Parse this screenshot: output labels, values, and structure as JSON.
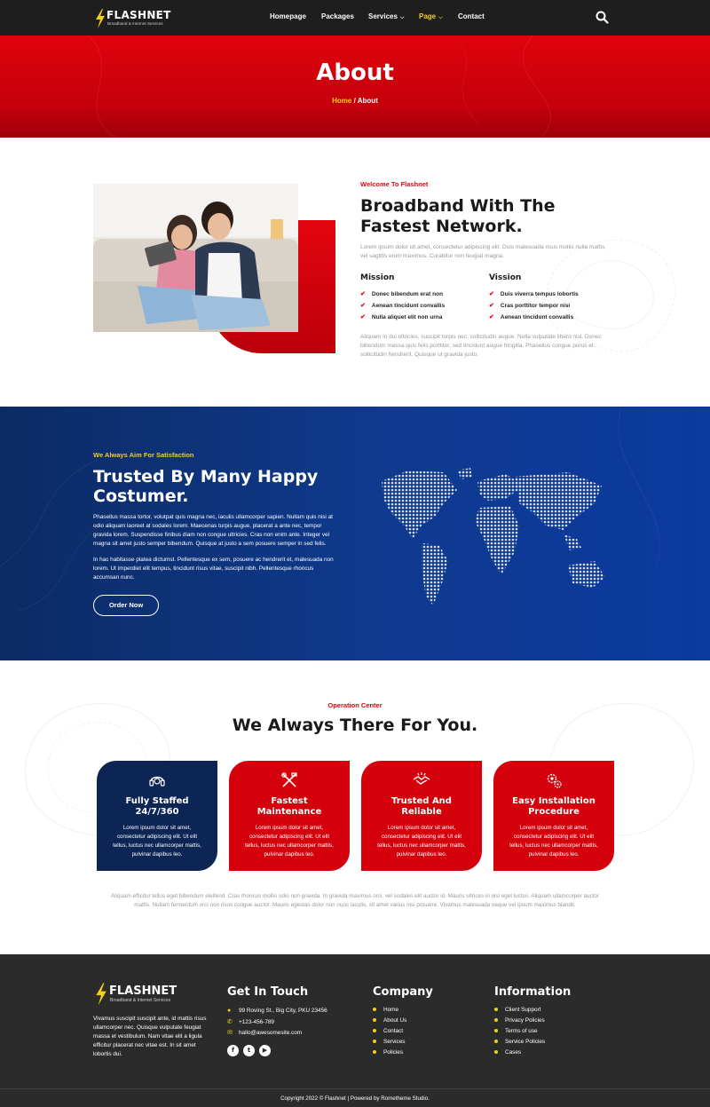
{
  "brand": {
    "name": "FLASHNET",
    "tagline": "Broadband & Internet Services"
  },
  "nav": {
    "items": [
      {
        "label": "Homepage"
      },
      {
        "label": "Packages"
      },
      {
        "label": "Services"
      },
      {
        "label": "Page"
      },
      {
        "label": "Contact"
      }
    ]
  },
  "hero": {
    "title": "About",
    "breadcrumb_home": "Home",
    "breadcrumb_separator": " / ",
    "breadcrumb_current": "About"
  },
  "about": {
    "kicker": "Welcome To Flashnet",
    "title_line1": "Broadband With The",
    "title_line2": "Fastest Network.",
    "intro_line1": "Lorem ipsum dolor sit amet, consectetur adipiscing elit. Duis malesuada risus mollis nulla mattis,",
    "intro_line2": "vel sagittis enim maximus. Curabitur non feugiat magna.",
    "mission": {
      "title": "Mission",
      "items": [
        "Donec bibendum erat non",
        "Aenean tincidunt convallis",
        "Nulla aliquet elit non urna"
      ]
    },
    "vission": {
      "title": "Vission",
      "items": [
        "Duis viverra tempus lobortis",
        "Cras porttitor tempor nisi",
        "Aenean tincidunt convallis"
      ]
    },
    "outro_line1": "Aliquam in dui ultricies, suscipit turpis nec, sollicitudin augue. Nulla vulputate libero nisl. Donec",
    "outro_line2": "bibendum massa quis felis porttitor, sed tincidunt augue fringilla. Phasellus congue purus et",
    "outro_line3": "sollicitudin hendrerit. Quisque ut gravida justo."
  },
  "trust": {
    "kicker": "We Always Aim For Satisfaction",
    "title_line1": "Trusted By Many Happy",
    "title_line2": "Costumer.",
    "p1_line1": "Phasellus massa tortor, volutpat quis magna nec, iaculis ullamcorper sapien. Nullam quis nisi at",
    "p1_line2": "odio aliquam laoreet at sodales lorem. Maecenas turpis augue, placerat a ante nec, tempor",
    "p1_line3": "gravida lorem. Suspendisse finibus diam non congue ultricies. Cras non enim ante. Integer vel",
    "p1_line4": "magna sit amet justo semper bibendum. Quisque at justo a sem posuere semper in sed felis.",
    "p2_line1": "In hac habitasse platea dictumst. Pellentesque ex sem, posuere ac hendrerit et, malesuada non",
    "p2_line2": "lorem. Ut imperdiet elit tempus, tincidunt risus vitae, suscipit nibh. Pellentesque rhoncus",
    "p2_line3": "accumsan nunc.",
    "button": "Order Now"
  },
  "operation": {
    "kicker": "Operation Center",
    "title": "We Always There For You.",
    "cards": [
      {
        "title_line1": "Fully Staffed",
        "title_line2": "24/7/360",
        "icon": "headset-icon",
        "color": "#0c2554"
      },
      {
        "title_line1": "Fastest",
        "title_line2": "Maintenance",
        "icon": "tools-icon",
        "color": "#d4000b"
      },
      {
        "title_line1": "Trusted And",
        "title_line2": "Reliable",
        "icon": "handshake-icon",
        "color": "#d4000b"
      },
      {
        "title_line1": "Easy Installation",
        "title_line2": "Procedure",
        "icon": "gears-icon",
        "color": "#d4000b"
      }
    ],
    "card_text_line1": "Lorem ipsum dolor sit amet,",
    "card_text_line2": "consectetur adipiscing elit. Ut elit",
    "card_text_line3": "tellus, luctus nec ullamcorper mattis,",
    "card_text_line4": "pulvinar dapibus leo.",
    "footnote_line1": "Aliquam efficitur tellus eget bibendum eleifend. Cras rhoncus mollis odio non gravida. In gravida maximus orci, vel sodales elit auctor id. Mauris ultrices in nisl eget luctus. Aliquam ullamcorper auctor",
    "footnote_line2": "mattis. Nullam fermentum orci non risus congue auctor. Mauris egestas dolor non nunc iaculis, sit amet varius nisi posuere. Vivamus malesuada neque vel ipsum maximus blandit."
  },
  "footer": {
    "about_line1": "Vivamus suscipit suscipit ante, id mattis risus",
    "about_line2": "ullamcorper nec. Quisque vulputate feugiat",
    "about_line3": "massa et vestibulum. Nam vitae elit a ligula",
    "about_line4": "efficitur placerat nec vitae est. In sit amet",
    "about_line5": "lobortis dui.",
    "contact_title": "Get In Touch",
    "address": "99 Roving St., Big City, PKU 23456",
    "phone": "+123-456-789",
    "email": "hallo@awesomesite.com",
    "company_title": "Company",
    "company_links": [
      "Home",
      "About Us",
      "Contact",
      "Services",
      "Policies"
    ],
    "info_title": "Information",
    "info_links": [
      "Client Support",
      "Privacy Policies",
      "Terms of use",
      "Service Policies",
      "Cases"
    ],
    "copyright": "Copyright 2022 © Flashnet | Powered by Rometheme Studio."
  },
  "colors": {
    "accent_red": "#e3050f",
    "navy": "#0c2554",
    "blue": "#0f3a8f",
    "yellow": "#f4cf19",
    "dark": "#1e1e1e"
  }
}
